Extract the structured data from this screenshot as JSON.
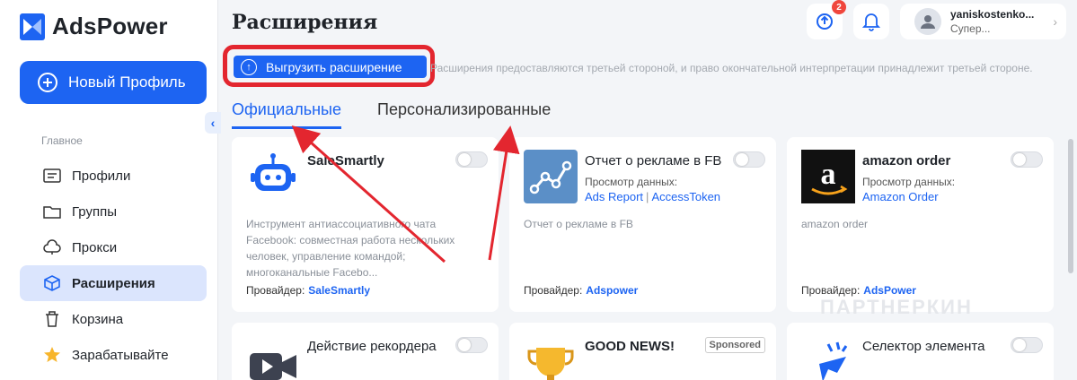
{
  "app": {
    "logo_text": "AdsPower",
    "new_profile_label": "Новый Профиль",
    "section_label": "Главное",
    "nav": [
      {
        "label": "Профили",
        "icon": "folder-list-icon"
      },
      {
        "label": "Группы",
        "icon": "folder-icon"
      },
      {
        "label": "Прокси",
        "icon": "cloud-icon"
      },
      {
        "label": "Расширения",
        "icon": "cube-icon",
        "active": true
      },
      {
        "label": "Корзина",
        "icon": "trash-icon"
      },
      {
        "label": "Зарабатывайте",
        "icon": "star-icon"
      }
    ]
  },
  "header": {
    "title": "Расширения",
    "sync_badge": "2",
    "user_name": "yaniskostenko...",
    "user_role": "Супер..."
  },
  "toolbar": {
    "upload_label": "Выгрузить расширение",
    "notice": "Расширения предоставляются третьей стороной, и право окончательной интерпретации принадлежит третьей стороне."
  },
  "tabs": [
    {
      "label": "Официальные",
      "active": true
    },
    {
      "label": "Персонализированные",
      "active": false
    }
  ],
  "cards": [
    {
      "title": "SaleSmartly",
      "description": "Инструмент антиассоциативного чата Facebook: совместная работа нескольких человек, управление командой; многоканальные Facebo...",
      "provider_label": "Провайдер:",
      "provider": "SaleSmartly"
    },
    {
      "title": "Отчет о рекламе в FB",
      "data_label": "Просмотр данных:",
      "links": [
        "Ads Report",
        "AccessToken"
      ],
      "description": "Отчет о рекламе в FB",
      "provider_label": "Провайдер:",
      "provider": "Adspower"
    },
    {
      "title": "amazon order",
      "data_label": "Просмотр данных:",
      "links": [
        "Amazon Order"
      ],
      "description": "amazon order",
      "provider_label": "Провайдер:",
      "provider": "AdsPower"
    },
    {
      "title": "Действие рекордера"
    },
    {
      "title": "GOOD NEWS!",
      "sponsored": "Sponsored"
    },
    {
      "title": "Селектор элемента"
    }
  ],
  "watermark": "ПАРТНЕРКИН",
  "colors": {
    "accent": "#1d64f2",
    "highlight": "#e3262f",
    "badge": "#f0463c"
  }
}
